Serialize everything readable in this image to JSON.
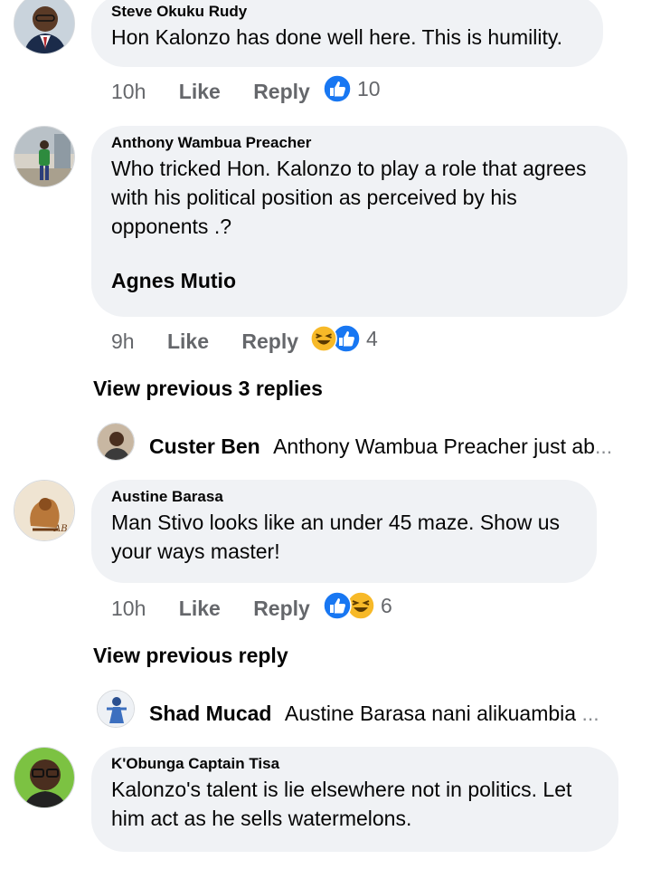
{
  "comments": [
    {
      "author": "Steve Okuku Rudy",
      "text": "Hon Kalonzo has done well here. This is humility.",
      "time": "10h",
      "like": "Like",
      "reply": "Reply",
      "reactions": [
        "like-icon"
      ],
      "count": "10"
    },
    {
      "author": "Anthony Wambua Preacher",
      "text": "Who tricked Hon. Kalonzo to play a role that agrees\nwith his political position as perceived by his\nopponents .?",
      "mention": "Agnes Mutio",
      "time": "9h",
      "like": "Like",
      "reply": "Reply",
      "reactions": [
        "haha-icon",
        "like-icon"
      ],
      "count": "4",
      "view_previous": "View previous 3 replies",
      "latest_reply": {
        "name": "Custer Ben",
        "text": "Anthony Wambua Preacher just ab",
        "ellipsis": "..."
      }
    },
    {
      "author": "Austine Barasa",
      "text": "Man Stivo looks like an under 45 maze. Show us\nyour ways master!",
      "time": "10h",
      "like": "Like",
      "reply": "Reply",
      "reactions": [
        "like-icon",
        "haha-icon"
      ],
      "count": "6",
      "view_previous": "View previous reply",
      "latest_reply": {
        "name": "Shad Mucad",
        "text": "Austine Barasa nani alikuambia",
        "ellipsis": "..."
      }
    },
    {
      "author": "K'Obunga Captain Tisa",
      "text": "Kalonzo's talent is lie elsewhere not in politics. Let\nhim act as he sells watermelons."
    }
  ],
  "colors": {
    "bubble": "#f0f2f5",
    "meta": "#65676b",
    "like_blue": "#1877f2",
    "haha_yellow": "#f7b928"
  }
}
